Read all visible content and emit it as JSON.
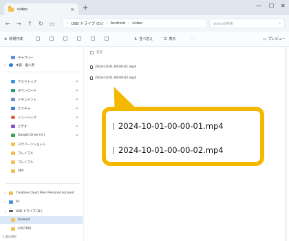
{
  "window": {
    "tab_title": "video",
    "tab_close_icon": "close-icon",
    "new_tab_icon": "plus-icon",
    "minimize_icon": "minimize-icon",
    "maximize_icon": "maximize-icon",
    "close_icon": "close-icon"
  },
  "address": {
    "crumbs": [
      "USB ドライブ (D:)",
      "Android",
      "video"
    ],
    "search_placeholder": "videoの検索"
  },
  "toolbar": {
    "new_label": "新規作成",
    "sort_label": "並べ替え",
    "view_label": "表示",
    "more_label": "···",
    "preview_label": "プレビュー"
  },
  "sidebar": {
    "items": [
      {
        "label": "ギャラリー"
      },
      {
        "label": "本部 - 個人用"
      },
      {
        "label": "デスクトップ"
      },
      {
        "label": "ダウンロード"
      },
      {
        "label": "ドキュメント"
      },
      {
        "label": "ピクチャ"
      },
      {
        "label": "ミュージック"
      },
      {
        "label": "ビデオ"
      },
      {
        "label": "Google Drive (G:)"
      },
      {
        "label": "スクリーンショット"
      },
      {
        "label": "ブレイブル"
      },
      {
        "label": "ブレイブル"
      },
      {
        "label": "SIM"
      },
      {
        "label": "Creative Cloud Files Personal Account"
      },
      {
        "label": "PC"
      },
      {
        "label": "USB ドライブ (D:)"
      },
      {
        "label": "Android"
      },
      {
        "label": "LOSTDIR"
      }
    ],
    "status": "2 個の項目"
  },
  "content": {
    "column_name": "名前",
    "files": [
      "2024-10-01-00-00-01.mp4",
      "2024-10-01-00-00-02.mp4"
    ]
  },
  "callout": {
    "files": [
      "2024-10-01-00-00-01.mp4",
      "2024-10-01-00-00-02.mp4"
    ]
  },
  "colors": {
    "callout_border": "#f5b800",
    "selection": "#dbe8f7",
    "folder": "#f2c14e"
  }
}
